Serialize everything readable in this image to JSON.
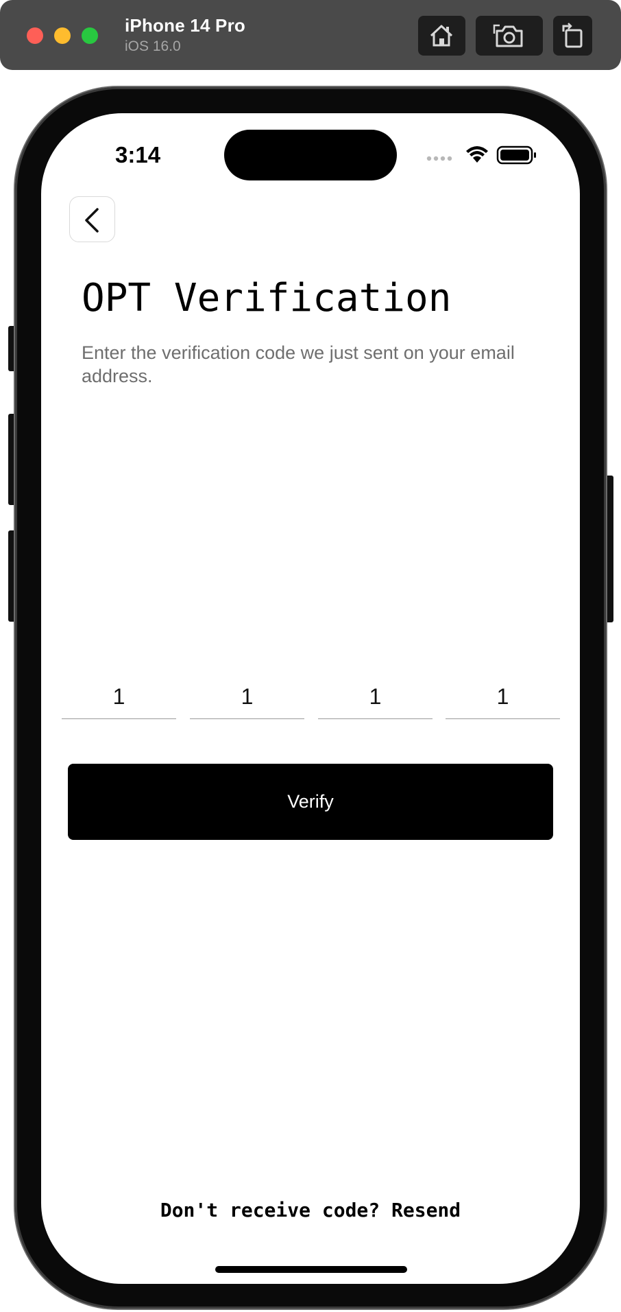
{
  "simulator": {
    "device_name": "iPhone 14 Pro",
    "os_version": "iOS 16.0",
    "buttons": [
      {
        "icon": "home-icon"
      },
      {
        "icon": "screenshot-icon"
      },
      {
        "icon": "rotate-icon"
      }
    ]
  },
  "status_bar": {
    "time": "3:14",
    "icons": [
      "cellular-dots-icon",
      "wifi-icon",
      "battery-icon"
    ]
  },
  "screen": {
    "back_icon": "chevron-left-icon",
    "title": "OPT Verification",
    "subtitle": "Enter the verification code we just sent on your email address.",
    "otp_digits": [
      "1",
      "1",
      "1",
      "1"
    ],
    "verify_label": "Verify",
    "resend_prompt": "Don't receive code?",
    "resend_link": "Resend"
  },
  "colors": {
    "primary": "#000000",
    "subtitle_text": "#6e6e6e",
    "background": "#ffffff"
  }
}
